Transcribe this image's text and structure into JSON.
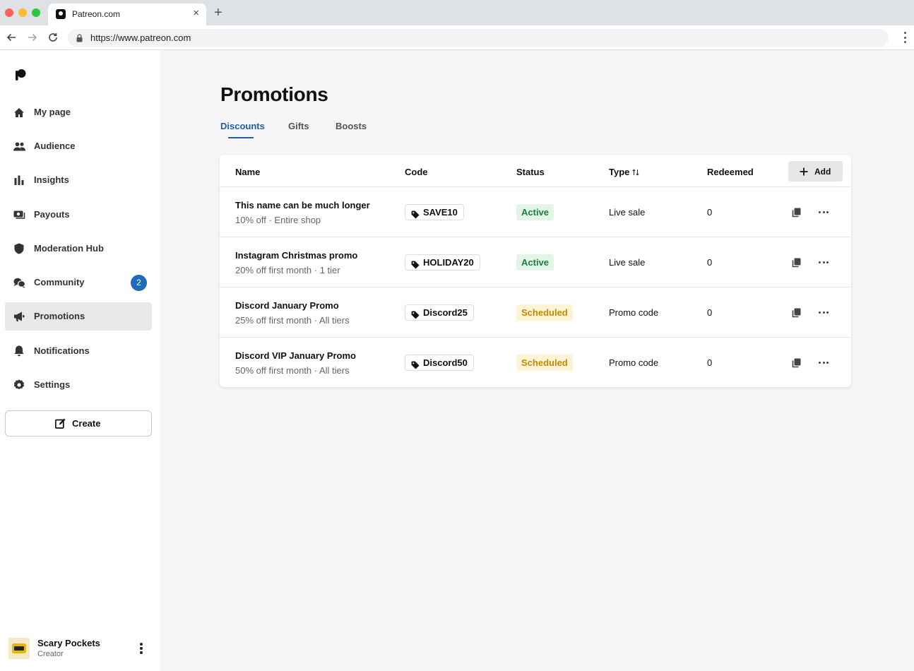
{
  "browser": {
    "tab_title": "Patreon.com",
    "url": "https://www.patreon.com"
  },
  "sidebar": {
    "items": [
      {
        "label": "My page",
        "icon": "home-icon"
      },
      {
        "label": "Audience",
        "icon": "people-icon"
      },
      {
        "label": "Insights",
        "icon": "bar-chart-icon"
      },
      {
        "label": "Payouts",
        "icon": "money-icon"
      },
      {
        "label": "Moderation Hub",
        "icon": "shield-icon"
      },
      {
        "label": "Community",
        "icon": "chat-bubbles-icon",
        "badge": "2"
      },
      {
        "label": "Promotions",
        "icon": "megaphone-icon",
        "active": true
      },
      {
        "label": "Notifications",
        "icon": "bell-icon"
      },
      {
        "label": "Settings",
        "icon": "gear-icon"
      }
    ],
    "create_label": "Create",
    "profile": {
      "name": "Scary Pockets",
      "role": "Creator"
    }
  },
  "main": {
    "title": "Promotions",
    "tabs": [
      "Discounts",
      "Gifts",
      "Boosts"
    ],
    "active_tab": "Discounts",
    "table": {
      "columns": [
        "Name",
        "Code",
        "Status",
        "Type",
        "Redeemed"
      ],
      "add_label": "Add",
      "rows": [
        {
          "name": "This name can be much longer",
          "desc": "10% off · Entire shop",
          "code": "SAVE10",
          "status": "Active",
          "type": "Live sale",
          "redeemed": "0"
        },
        {
          "name": "Instagram Christmas promo",
          "desc": "20% off first month · 1 tier",
          "code": "HOLIDAY20",
          "status": "Active",
          "type": "Live sale",
          "redeemed": "0"
        },
        {
          "name": "Discord January Promo",
          "desc": "25% off first month · All tiers",
          "code": "Discord25",
          "status": "Scheduled",
          "type": "Promo code",
          "redeemed": "0"
        },
        {
          "name": "Discord VIP January Promo",
          "desc": "50% off first month · All tiers",
          "code": "Discord50",
          "status": "Scheduled",
          "type": "Promo code",
          "redeemed": "0"
        }
      ]
    }
  },
  "colors": {
    "accent": "#1d5fa8",
    "badge": "#1d6dbd",
    "status_active_bg": "#e3f5e8",
    "status_active_text": "#1a7f3c",
    "status_scheduled_bg": "#fff3d6",
    "status_scheduled_text": "#c08a00"
  }
}
